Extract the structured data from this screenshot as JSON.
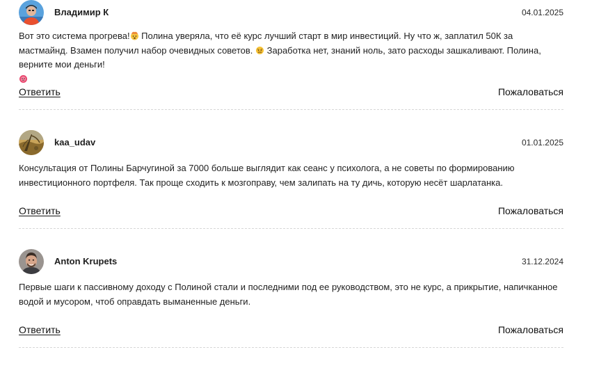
{
  "comments": [
    {
      "author": "Владимир К",
      "date": "04.01.2025",
      "text_part1": "Вот это система прогрева!",
      "text_part2": " Полина уверяла, что её курс лучший старт в мир инвестиций. Ну что ж, заплатил 50К за мастмайнд. Взамен получил набор очевидных советов. ",
      "text_part3": " Заработка нет, знаний ноль, зато расходы зашкаливают. Полина, верните мои деньги!",
      "reply_label": "Ответить",
      "report_label": "Пожаловаться"
    },
    {
      "author": "kaa_udav",
      "date": "01.01.2025",
      "text": "Консультация от Полины Барчугиной за 7000 больше выглядит как сеанс у психолога, а не советы по формированию инвестиционного портфеля. Так проще сходить к мозгоправу, чем залипать на ту дичь, которую несёт шарлатанка.",
      "reply_label": "Ответить",
      "report_label": "Пожаловаться"
    },
    {
      "author": "Anton Krupets",
      "date": "31.12.2024",
      "text": "Первые шаги к пассивному доходу с Полиной стали и последними под ее руководством, это не курс, а прикрытие, напичканное водой и мусором, чтоб оправдать выманенные деньги.",
      "reply_label": "Ответить",
      "report_label": "Пожаловаться"
    }
  ],
  "icons": {
    "emoji_1": "exploding-head-emoji-icon",
    "emoji_2": "angry-face-emoji-icon",
    "emoji_3": "pleading-face-emoji-icon"
  }
}
